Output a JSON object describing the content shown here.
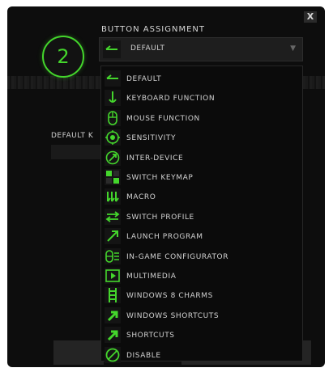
{
  "header": {
    "close_label": "X",
    "number": "2",
    "title": "BUTTON ASSIGNMENT"
  },
  "select": {
    "value": "DEFAULT",
    "icon": "default-icon",
    "caret": "▼"
  },
  "background": {
    "default_label": "DEFAULT K"
  },
  "menu": {
    "items": [
      {
        "label": "DEFAULT",
        "icon": "default-icon"
      },
      {
        "label": "KEYBOARD FUNCTION",
        "icon": "keyboard-function-icon"
      },
      {
        "label": "MOUSE FUNCTION",
        "icon": "mouse-icon"
      },
      {
        "label": "SENSITIVITY",
        "icon": "sensitivity-icon"
      },
      {
        "label": "INTER-DEVICE",
        "icon": "inter-device-icon"
      },
      {
        "label": "SWITCH KEYMAP",
        "icon": "switch-keymap-icon"
      },
      {
        "label": "MACRO",
        "icon": "macro-icon"
      },
      {
        "label": "SWITCH PROFILE",
        "icon": "switch-profile-icon"
      },
      {
        "label": "LAUNCH PROGRAM",
        "icon": "launch-program-icon"
      },
      {
        "label": "IN-GAME CONFIGURATOR",
        "icon": "in-game-configurator-icon"
      },
      {
        "label": "MULTIMEDIA",
        "icon": "multimedia-icon"
      },
      {
        "label": "WINDOWS 8 CHARMS",
        "icon": "windows-charms-icon"
      },
      {
        "label": "WINDOWS SHORTCUTS",
        "icon": "windows-shortcuts-icon"
      },
      {
        "label": "SHORTCUTS",
        "icon": "shortcuts-icon"
      },
      {
        "label": "DISABLE",
        "icon": "disable-icon"
      }
    ]
  },
  "colors": {
    "accent": "#44d62c",
    "panel": "#0d0d0d",
    "text": "#d2d2d2"
  }
}
